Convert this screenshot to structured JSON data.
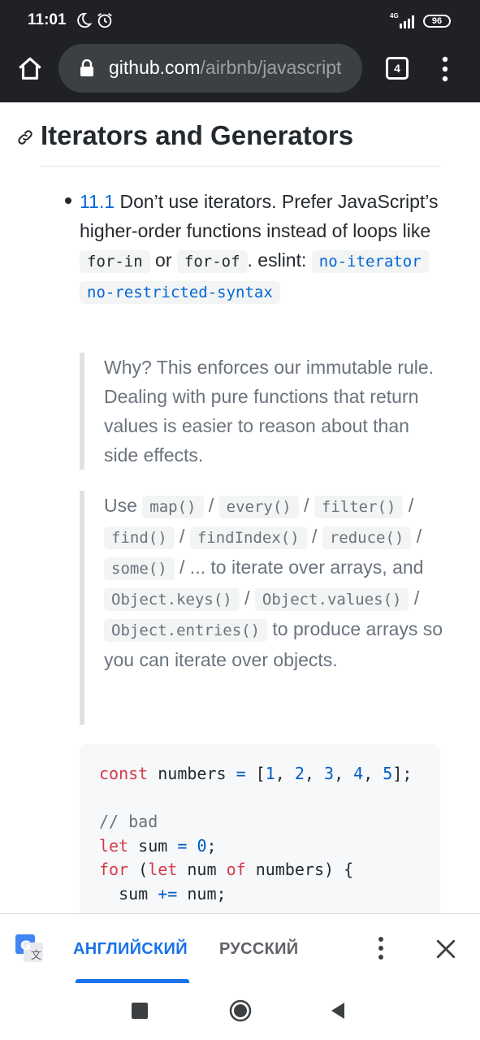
{
  "status_bar": {
    "time": "11:01",
    "network": "4G",
    "battery": "96",
    "icons": [
      "moon-icon",
      "alarm-icon",
      "signal-icon",
      "battery-icon"
    ]
  },
  "browser": {
    "url_host": "github.com",
    "url_path": "/airbnb/javascript",
    "tab_count": "4",
    "icons": [
      "home-icon",
      "lock-icon",
      "tab-switcher-icon",
      "more-vert-icon"
    ]
  },
  "article": {
    "heading": "Iterators and Generators",
    "rule": {
      "number": "11.1",
      "text_1": " Don’t use iterators. Prefer JavaScript’s higher-order functions instead of loops like ",
      "code_for_in": "for-in",
      "text_or": " or ",
      "code_for_of": "for-of",
      "text_eslint": ". eslint: ",
      "lint_1": "no-iterator",
      "lint_2": "no-restricted-syntax"
    },
    "quote_why": "Why? This enforces our immutable rule. Dealing with pure functions that return values is easier to reason about than side effects.",
    "quote_use": {
      "use": "Use ",
      "methods": [
        "map()",
        "every()",
        "filter()",
        "find()",
        "findIndex()",
        "reduce()",
        "some()"
      ],
      "sep": " / ",
      "ellipsis": " / ... to iterate over arrays, and ",
      "obj_keys": "Object.keys()",
      "obj_values": "Object.values()",
      "obj_entries": "Object.entries()",
      "tail": " to produce arrays so you can iterate over objects."
    },
    "code": {
      "line1": [
        "const",
        " numbers ",
        "=",
        " [",
        "1",
        ", ",
        "2",
        ", ",
        "3",
        ", ",
        "4",
        ", ",
        "5",
        "];"
      ],
      "comment_bad": "// bad",
      "line_let": [
        "let",
        " sum ",
        "=",
        " ",
        "0",
        ";"
      ],
      "line_for": [
        "for",
        " (",
        "let",
        " num ",
        "of",
        " numbers) {"
      ],
      "line_sum": [
        "  sum ",
        "+=",
        " num;"
      ]
    }
  },
  "translate_bar": {
    "lang_source": "АНГЛИЙСКИЙ",
    "lang_target": "РУССКИЙ",
    "accent": "#1a73e8",
    "icons": [
      "google-translate-icon",
      "more-vert-icon",
      "close-icon"
    ]
  },
  "nav_bar": {
    "icons": [
      "recents-icon",
      "home-circle-icon",
      "back-icon"
    ]
  }
}
